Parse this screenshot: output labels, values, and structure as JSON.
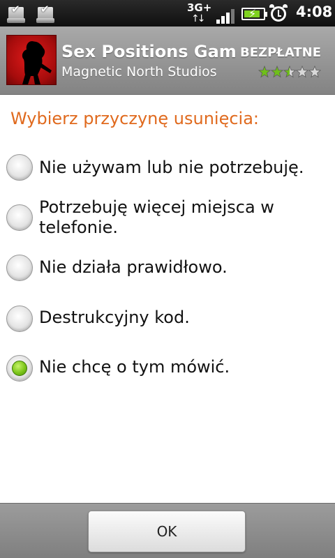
{
  "status_bar": {
    "network": "3G+",
    "time": "4:08",
    "notifications": [
      "download-complete-icon",
      "download-complete-icon"
    ],
    "battery_level": 0.85,
    "signal_bars": 4
  },
  "app": {
    "title": "Sex Positions Game",
    "price": "BEZPŁATNE",
    "developer": "Magnetic North Studios",
    "rating": 2.5,
    "rating_max": 5
  },
  "uninstall_dialog": {
    "prompt": "Wybierz przyczynę usunięcia:",
    "options": [
      {
        "label": "Nie używam lub nie potrzebuję.",
        "selected": false
      },
      {
        "label": "Potrzebuję więcej miejsca w telefonie.",
        "selected": false
      },
      {
        "label": "Nie działa prawidłowo.",
        "selected": false
      },
      {
        "label": "Destrukcyjny kod.",
        "selected": false
      },
      {
        "label": "Nie chcę o tym mówić.",
        "selected": true
      }
    ],
    "ok_label": "OK"
  },
  "colors": {
    "prompt": "#e06a1e",
    "radio_selected": "#7cc519",
    "star_filled": "#6fbf1a"
  }
}
